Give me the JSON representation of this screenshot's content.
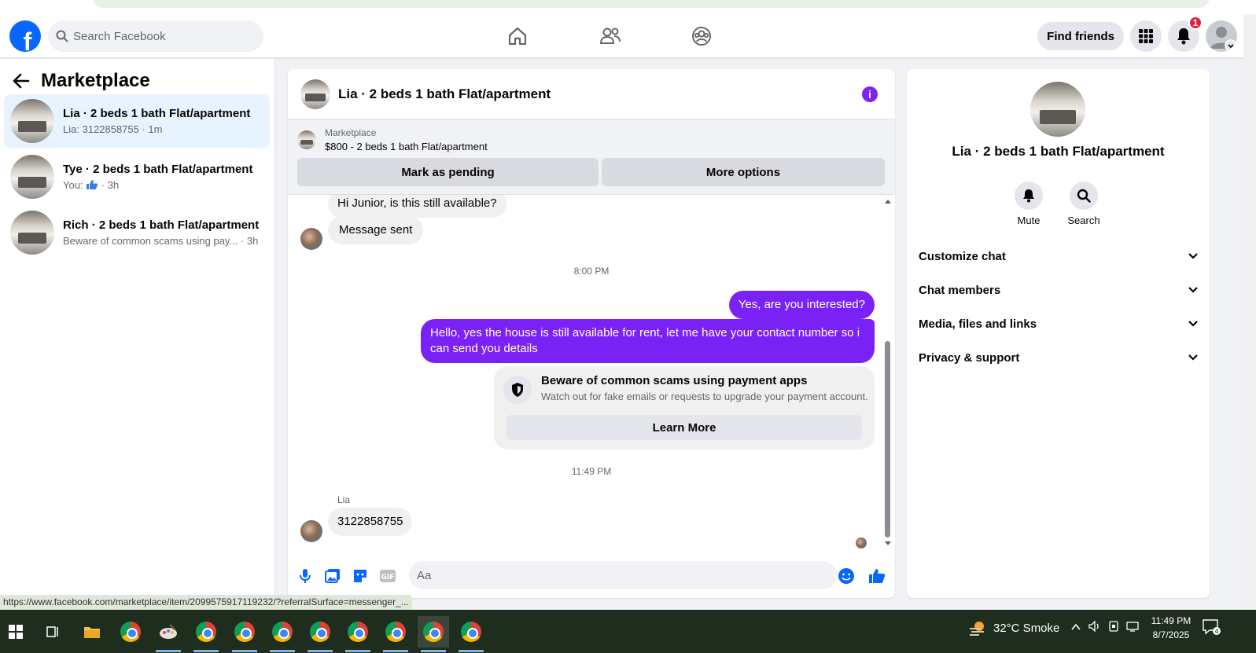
{
  "browser": {
    "status_url": "https://www.facebook.com/marketplace/item/2099575917119232/?referralSurface=messenger_..."
  },
  "header": {
    "logo_letter": "f",
    "search_placeholder": "Search Facebook",
    "find_friends_label": "Find friends",
    "notifications_count": "1",
    "brand_color": "#0866ff"
  },
  "sidebar": {
    "title": "Marketplace",
    "conversations": [
      {
        "name": "Lia · 2 beds 1 bath Flat/apartment",
        "preview": "Lia: 3122858755 · 1m",
        "active": true
      },
      {
        "name": "Tye · 2 beds 1 bath Flat/apartment",
        "preview_prefix": "You:",
        "preview_suffix": " · 3h"
      },
      {
        "name": "Rich · 2 beds 1 bath Flat/apartment",
        "preview": "Beware of common scams using pay...",
        "time": " · 3h"
      }
    ]
  },
  "chat": {
    "title": "Lia · 2 beds 1 bath Flat/apartment",
    "listing": {
      "label": "Marketplace",
      "price_line": "$800 - 2 beds 1 bath Flat/apartment"
    },
    "mark_pending_label": "Mark as pending",
    "more_options_label": "More options",
    "messages": {
      "first_in": "Hi Junior, is this still available?",
      "second_in": "Message sent",
      "time_1": "8:00 PM",
      "out_1": "Yes, are you interested?",
      "out_2_line1": "Hello, yes the house is still available for rent, let me have your contact number so i",
      "out_2_line2": "can send you details",
      "warning_title": "Beware of common scams using payment apps",
      "warning_desc": "Watch out for fake emails or requests to upgrade your payment account.",
      "learn_more": "Learn More",
      "time_2": "11:49 PM",
      "sender": "Lia",
      "last_in": "3122858755"
    },
    "composer_placeholder": "Aa",
    "accent_color": "#7a21f6"
  },
  "info_panel": {
    "name": "Lia · 2 beds 1 bath Flat/apartment",
    "mute_label": "Mute",
    "search_label": "Search",
    "sections": [
      "Customize chat",
      "Chat members",
      "Media, files and links",
      "Privacy & support"
    ]
  },
  "taskbar": {
    "weather": "32°C  Smoke",
    "time": "11:49 PM",
    "date": "8/7/2025",
    "notification_count": "4"
  }
}
